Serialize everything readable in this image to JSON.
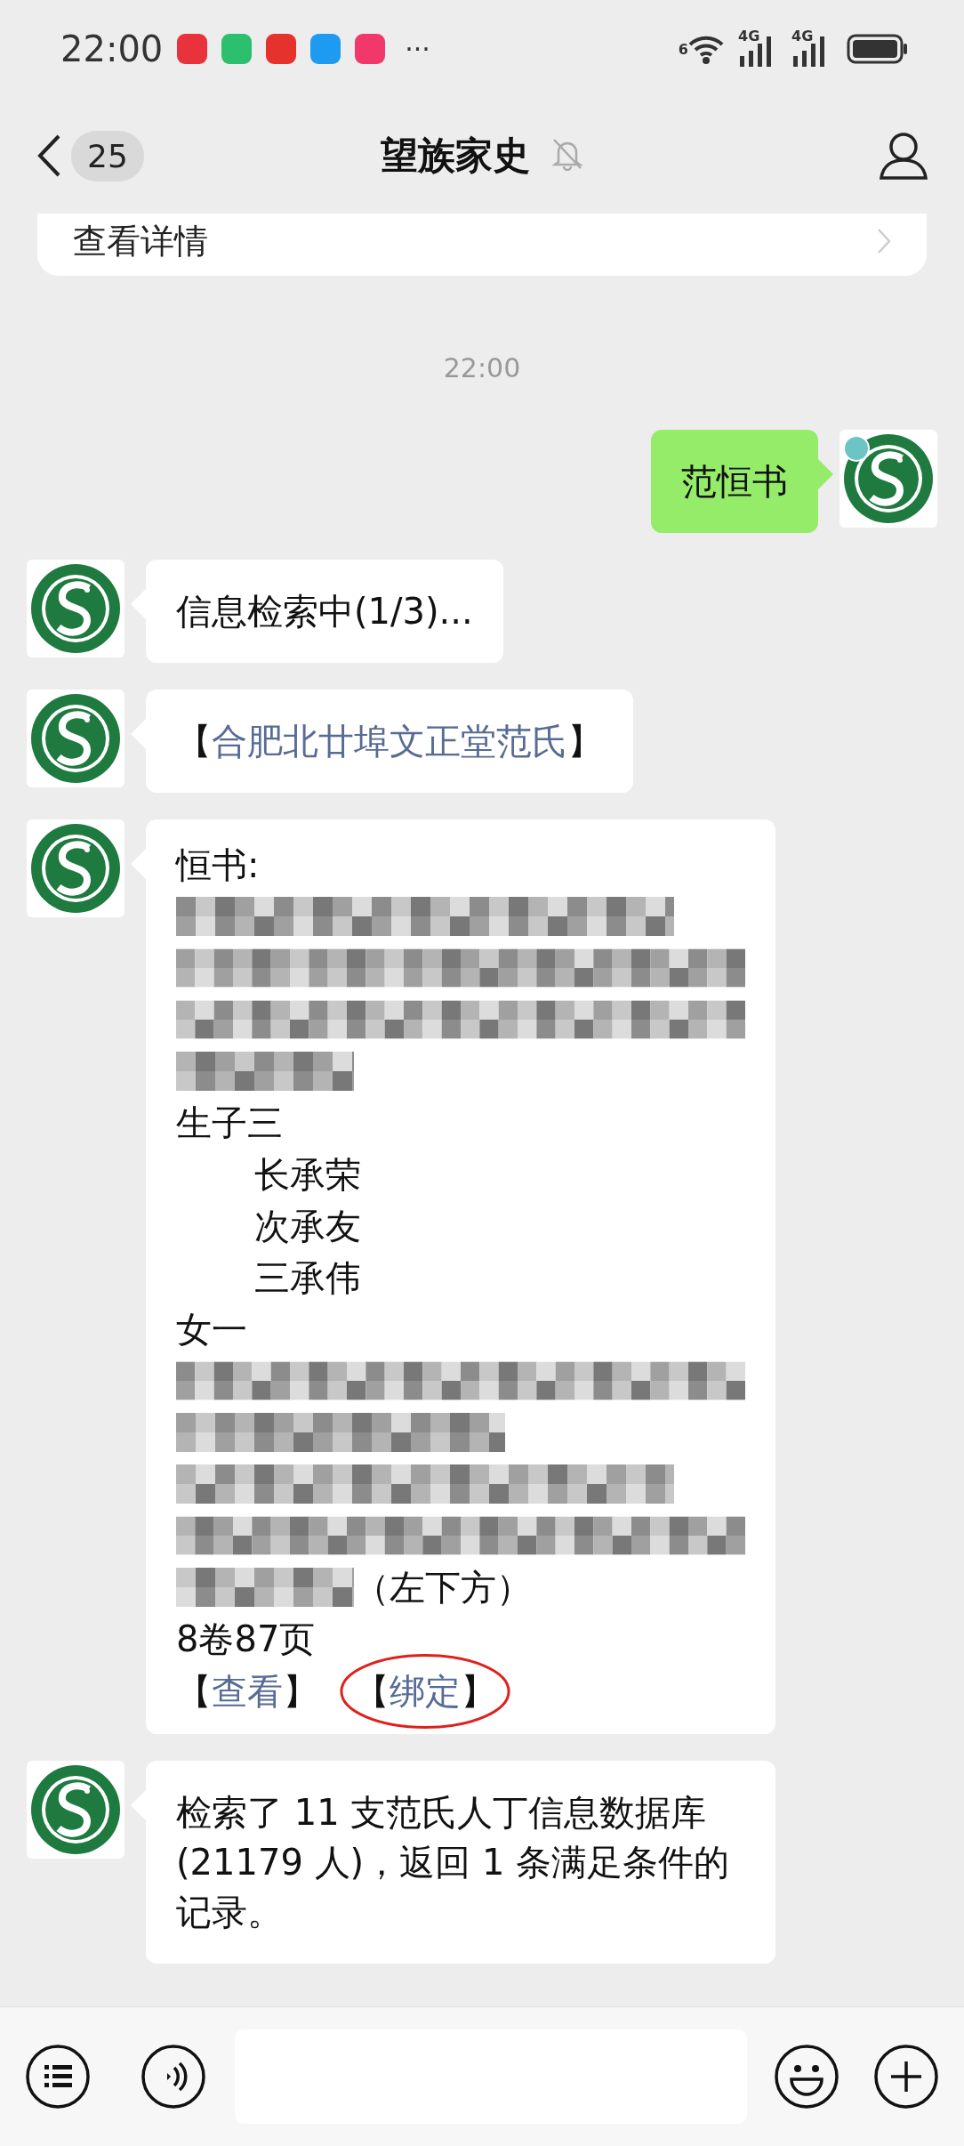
{
  "status_bar": {
    "time": "22:00",
    "app_icons": [
      {
        "color": "#e8333c"
      },
      {
        "color": "#2bbf6e"
      },
      {
        "color": "#e5322d"
      },
      {
        "color": "#1e9bf0"
      },
      {
        "color": "#f0386b"
      }
    ],
    "more": "···",
    "wifi_badge": "6",
    "networks": [
      "4G",
      "4G"
    ]
  },
  "nav": {
    "unread": "25",
    "title": "望族家史",
    "muted": true
  },
  "card": {
    "text": "查看详情"
  },
  "timestamp": "22:00",
  "messages": [
    {
      "kind": "sent",
      "text": "范恒书"
    },
    {
      "kind": "text",
      "text": "信息检索中(1/3)..."
    },
    {
      "kind": "link",
      "open": "【",
      "text": "合肥北廿埠文正堂范氏",
      "close": "】"
    },
    {
      "kind": "record",
      "lines": [
        {
          "kind": "text",
          "text": "恒书:"
        },
        {
          "kind": "long"
        },
        {
          "kind": "full"
        },
        {
          "kind": "full"
        },
        {
          "kind": "short"
        },
        {
          "kind": "text",
          "text": "生子三"
        },
        {
          "kind": "indent",
          "text": "长承荣"
        },
        {
          "kind": "indent",
          "text": "次承友"
        },
        {
          "kind": "indent",
          "text": "三承伟"
        },
        {
          "kind": "text",
          "text": "女一"
        },
        {
          "kind": "full"
        },
        {
          "kind": "half"
        },
        {
          "kind": "long"
        },
        {
          "kind": "full"
        },
        {
          "kind": "short",
          "tail": "（左下方）"
        },
        {
          "kind": "text",
          "text": "8卷87页"
        }
      ],
      "actions": [
        {
          "open": "【",
          "text": "查看",
          "close": "】",
          "circled": false
        },
        {
          "open": "【",
          "text": "绑定",
          "close": "】",
          "circled": true
        }
      ]
    },
    {
      "kind": "text",
      "text": "检索了 11 支范氏人丁信息数据库 (21179 人)，返回 1 条满足条件的记录。"
    }
  ]
}
